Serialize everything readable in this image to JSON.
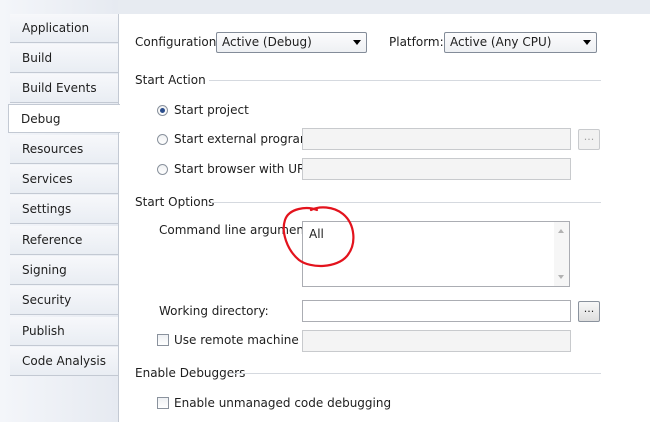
{
  "sidebar": {
    "items": [
      {
        "label": "Application"
      },
      {
        "label": "Build"
      },
      {
        "label": "Build Events"
      },
      {
        "label": "Debug",
        "selected": true
      },
      {
        "label": "Resources"
      },
      {
        "label": "Services"
      },
      {
        "label": "Settings"
      },
      {
        "label": "Reference Paths"
      },
      {
        "label": "Signing"
      },
      {
        "label": "Security"
      },
      {
        "label": "Publish"
      },
      {
        "label": "Code Analysis"
      }
    ]
  },
  "config": {
    "configuration_label": "Configuration:",
    "configuration_value": "Active (Debug)",
    "platform_label": "Platform:",
    "platform_value": "Active (Any CPU)"
  },
  "start_action": {
    "title": "Start Action",
    "start_project": "Start project",
    "start_external_program": "Start external program:",
    "start_browser": "Start browser with URL:",
    "browse_label": "...",
    "selected": "start_project"
  },
  "start_options": {
    "title": "Start Options",
    "command_line_label": "Command line arguments:",
    "command_line_value": "All",
    "working_directory_label": "Working directory:",
    "working_directory_value": "",
    "browse_label": "...",
    "use_remote_label": "Use remote machine",
    "remote_machine_value": ""
  },
  "enable_debuggers": {
    "title": "Enable Debuggers",
    "unmanaged_label": "Enable unmanaged code debugging"
  },
  "colors": {
    "annotation_circle": "#e3131d",
    "selected_radio": "#2b4d8c"
  }
}
